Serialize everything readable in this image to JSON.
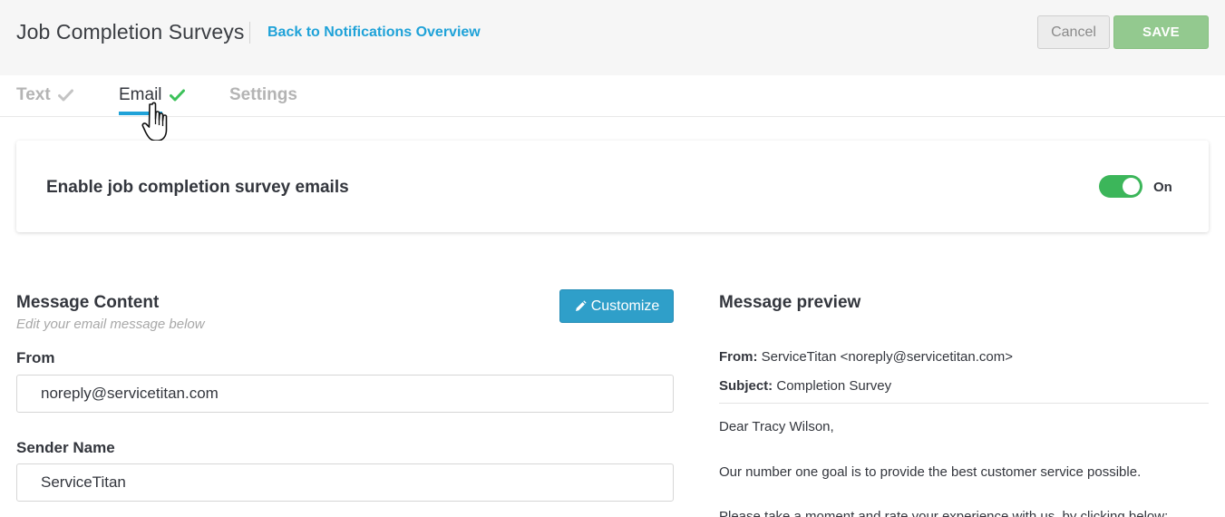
{
  "header": {
    "title": "Job Completion Surveys",
    "back_link": "Back to Notifications Overview",
    "cancel_label": "Cancel",
    "save_label": "SAVE"
  },
  "tabs": [
    {
      "label": "Text",
      "check": "check-icon",
      "state": "complete"
    },
    {
      "label": "Email",
      "check": "check-icon",
      "state": "active"
    },
    {
      "label": "Settings",
      "state": "inactive"
    }
  ],
  "enable": {
    "label": "Enable job completion survey emails",
    "toggle_state": "On"
  },
  "message_content": {
    "title": "Message Content",
    "subtitle": "Edit your email message below",
    "customize_label": "Customize",
    "from_label": "From",
    "from_value": "noreply@servicetitan.com",
    "sender_label": "Sender Name",
    "sender_value": "ServiceTitan"
  },
  "preview": {
    "title": "Message preview",
    "from_key": "From:",
    "from_value": " ServiceTitan <noreply@servicetitan.com>",
    "subject_key": "Subject:",
    "subject_value": " Completion Survey",
    "greeting": "Dear Tracy Wilson,",
    "body1": "Our number one goal is to provide the best customer service possible.",
    "body2": "Please take a moment and rate your experience with us, by clicking below:"
  },
  "colors": {
    "accent": "#1fa2d8",
    "save": "#93c98f",
    "toggle_on": "#3cb65a",
    "check_active": "#3cc15a",
    "check_inactive": "#c4c4c4"
  }
}
